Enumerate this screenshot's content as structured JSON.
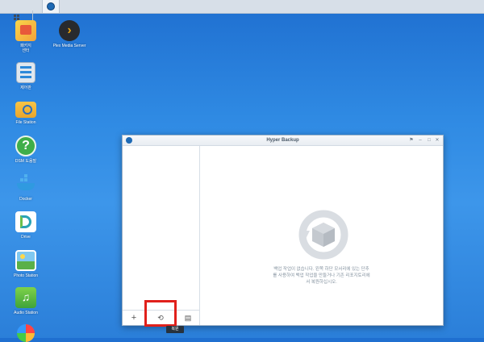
{
  "desktop": {
    "icons": [
      {
        "label": "패키지\n센터",
        "icon": "package-center-icon"
      },
      {
        "label": "제어판",
        "icon": "control-panel-icon"
      },
      {
        "label": "File Station",
        "icon": "file-station-icon"
      },
      {
        "label": "DSM 도움말",
        "icon": "help-icon"
      },
      {
        "label": "Docker",
        "icon": "docker-icon"
      },
      {
        "label": "Drive",
        "icon": "drive-icon"
      },
      {
        "label": "Photo Station",
        "icon": "photo-station-icon"
      },
      {
        "label": "Audio Station",
        "icon": "audio-station-icon"
      },
      {
        "label": "Plex Media Server",
        "icon": "plex-icon"
      }
    ]
  },
  "window": {
    "title": "Hyper Backup",
    "empty_message": "백업 작업이 없습니다. 왼쪽 하단 모서리에 있는 단추\n를 사용하여 백업 작업을 만들거나 기존 리포지토리에\n서 복원하십시오."
  },
  "tooltip": {
    "text": "복원"
  },
  "colors": {
    "highlight": "#e0201b",
    "accent": "#1e6ab5"
  }
}
